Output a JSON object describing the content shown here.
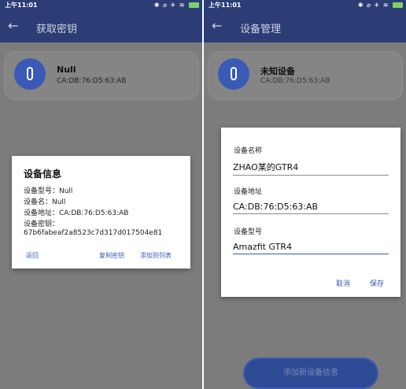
{
  "status_bar": {
    "time": "上午11:01",
    "icons": "✱ ⌀ ✈ ≋",
    "battery_color": "#7bd36b"
  },
  "left_screen": {
    "title": "获取密钥",
    "device_card": {
      "name": "Null",
      "mac": "CA:DB:76:D5:63:AB"
    },
    "info_dialog": {
      "title": "设备信息",
      "model_line": "设备型号：Null",
      "name_line": "设备名：Null",
      "address_line": "设备地址：CA:DB:76:D5:63:AB",
      "key_label": "设备密钥：",
      "key_value": "67b6fabeaf2a8523c7d317d017504e81",
      "buttons": {
        "back": "返回",
        "copy_key": "复制密钥",
        "add_to_list": "添加到列表"
      }
    }
  },
  "right_screen": {
    "title": "设备管理",
    "device_card": {
      "name": "未知设备",
      "mac": "CA:DB:76:D5:63:AB"
    },
    "edit_dialog": {
      "fields": [
        {
          "label": "设备名称",
          "value": "ZHAO某的GTR4"
        },
        {
          "label": "设备地址",
          "value": "CA:DB:76:D5:63:AB"
        },
        {
          "label": "设备型号",
          "value": "Amazfit GTR4"
        }
      ],
      "buttons": {
        "cancel": "取消",
        "save": "保存"
      }
    },
    "bottom_button": "添加新设备信息"
  },
  "colors": {
    "app_bar": "#2c3d76",
    "accent": "#3a5ab5",
    "scrim": "#7c7c7c"
  }
}
